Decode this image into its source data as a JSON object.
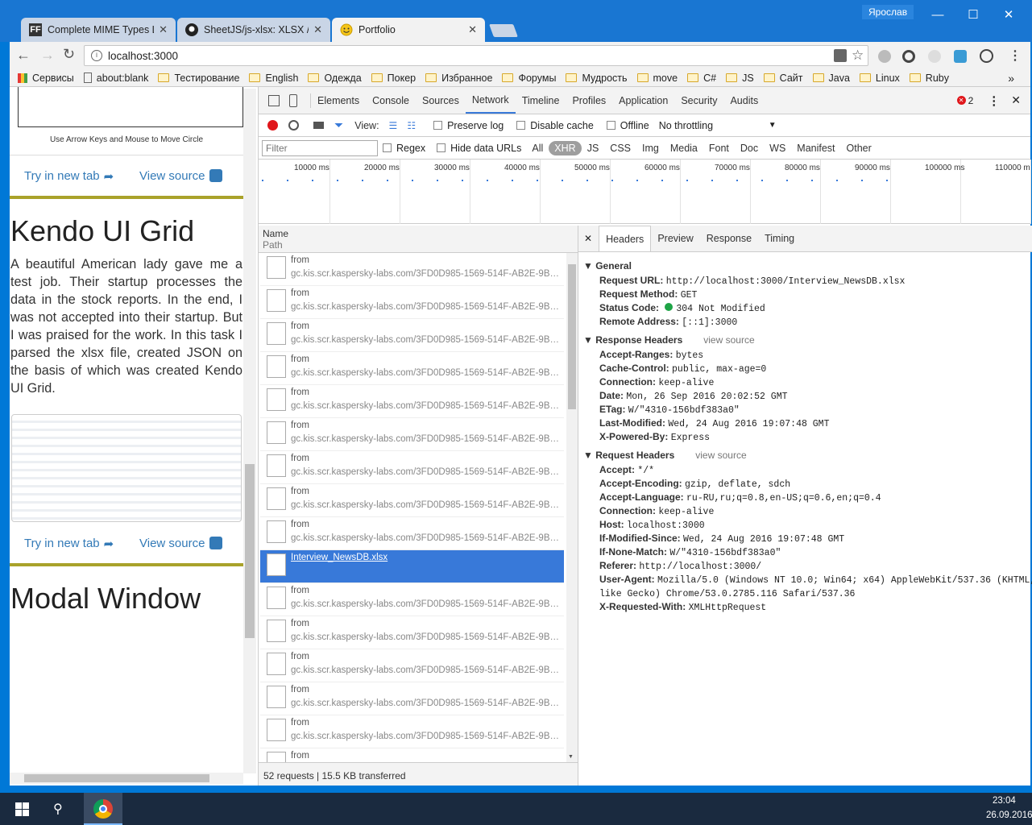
{
  "window": {
    "user": "Ярослав",
    "minimize": "—",
    "maximize": "☐",
    "close": "✕"
  },
  "tabs": [
    {
      "label": "Complete MIME Types Li",
      "favicon": "FF"
    },
    {
      "label": "SheetJS/js-xlsx: XLSX / XL",
      "favicon": "github-icon"
    },
    {
      "label": "Portfolio",
      "favicon": "smiley-icon"
    }
  ],
  "address": {
    "url": "localhost:3000"
  },
  "bookmarks": [
    "Сервисы",
    "about:blank",
    "Тестирование",
    "English",
    "Одежда",
    "Покер",
    "Избранное",
    "Форумы",
    "Мудрость",
    "move",
    "C#",
    "JS",
    "Сайт",
    "Java",
    "Linux",
    "Ruby"
  ],
  "page": {
    "canvas_caption": "Use Arrow Keys and Mouse to Move Circle",
    "try_link": "Try in new tab",
    "source_link": "View source",
    "section1_title": "Kendo UI Grid",
    "section1_text": "A beautiful American lady gave me a test job. Their startup processes the data in the stock reports. In the end, I was not accepted into their startup. But I was praised for the work. In this task I parsed the xlsx file, created JSON on the basis of which was created Kendo UI Grid.",
    "section2_title": "Modal Window"
  },
  "devtools": {
    "tabs": [
      "Elements",
      "Console",
      "Sources",
      "Network",
      "Timeline",
      "Profiles",
      "Application",
      "Security",
      "Audits"
    ],
    "active_tab": "Network",
    "error_count": "2",
    "view_label": "View:",
    "preserve_log": "Preserve log",
    "disable_cache": "Disable cache",
    "offline": "Offline",
    "throttling": "No throttling",
    "filter_placeholder": "Filter",
    "regex": "Regex",
    "hide_data_urls": "Hide data URLs",
    "types": [
      "All",
      "XHR",
      "JS",
      "CSS",
      "Img",
      "Media",
      "Font",
      "Doc",
      "WS",
      "Manifest",
      "Other"
    ],
    "active_type": "XHR",
    "timeline_ticks": [
      "10000 ms",
      "20000 ms",
      "30000 ms",
      "40000 ms",
      "50000 ms",
      "60000 ms",
      "70000 ms",
      "80000 ms",
      "90000 ms",
      "100000 ms",
      "110000 m"
    ],
    "col_name": "Name",
    "col_path": "Path",
    "requests": [
      {
        "name": "from",
        "path": "gc.kis.scr.kaspersky-labs.com/3FD0D985-1569-514F-AB2E-9B42D64..."
      },
      {
        "name": "from",
        "path": "gc.kis.scr.kaspersky-labs.com/3FD0D985-1569-514F-AB2E-9B42D64..."
      },
      {
        "name": "from",
        "path": "gc.kis.scr.kaspersky-labs.com/3FD0D985-1569-514F-AB2E-9B42D64..."
      },
      {
        "name": "from",
        "path": "gc.kis.scr.kaspersky-labs.com/3FD0D985-1569-514F-AB2E-9B42D64..."
      },
      {
        "name": "from",
        "path": "gc.kis.scr.kaspersky-labs.com/3FD0D985-1569-514F-AB2E-9B42D64..."
      },
      {
        "name": "from",
        "path": "gc.kis.scr.kaspersky-labs.com/3FD0D985-1569-514F-AB2E-9B42D64..."
      },
      {
        "name": "from",
        "path": "gc.kis.scr.kaspersky-labs.com/3FD0D985-1569-514F-AB2E-9B42D64..."
      },
      {
        "name": "from",
        "path": "gc.kis.scr.kaspersky-labs.com/3FD0D985-1569-514F-AB2E-9B42D64..."
      },
      {
        "name": "from",
        "path": "gc.kis.scr.kaspersky-labs.com/3FD0D985-1569-514F-AB2E-9B42D64..."
      },
      {
        "name": "Interview_NewsDB.xlsx",
        "path": ""
      },
      {
        "name": "from",
        "path": "gc.kis.scr.kaspersky-labs.com/3FD0D985-1569-514F-AB2E-9B42D64..."
      },
      {
        "name": "from",
        "path": "gc.kis.scr.kaspersky-labs.com/3FD0D985-1569-514F-AB2E-9B42D64..."
      },
      {
        "name": "from",
        "path": "gc.kis.scr.kaspersky-labs.com/3FD0D985-1569-514F-AB2E-9B42D64..."
      },
      {
        "name": "from",
        "path": "gc.kis.scr.kaspersky-labs.com/3FD0D985-1569-514F-AB2E-9B42D64..."
      },
      {
        "name": "from",
        "path": "gc.kis.scr.kaspersky-labs.com/3FD0D985-1569-514F-AB2E-9B42D64..."
      },
      {
        "name": "from",
        "path": ""
      }
    ],
    "selected_request": 9,
    "summary": "52 requests  |  15.5 KB transferred",
    "detail_tabs": [
      "Headers",
      "Preview",
      "Response",
      "Timing"
    ],
    "general_title": "General",
    "general": [
      {
        "k": "Request URL:",
        "v": "http://localhost:3000/Interview_NewsDB.xlsx"
      },
      {
        "k": "Request Method:",
        "v": "GET"
      },
      {
        "k": "Status Code:",
        "v": "304 Not Modified"
      },
      {
        "k": "Remote Address:",
        "v": "[::1]:3000"
      }
    ],
    "response_title": "Response Headers",
    "view_source": "view source",
    "response": [
      {
        "k": "Accept-Ranges:",
        "v": "bytes"
      },
      {
        "k": "Cache-Control:",
        "v": "public, max-age=0"
      },
      {
        "k": "Connection:",
        "v": "keep-alive"
      },
      {
        "k": "Date:",
        "v": "Mon, 26 Sep 2016 20:02:52 GMT"
      },
      {
        "k": "ETag:",
        "v": "W/\"4310-156bdf383a0\""
      },
      {
        "k": "Last-Modified:",
        "v": "Wed, 24 Aug 2016 19:07:48 GMT"
      },
      {
        "k": "X-Powered-By:",
        "v": "Express"
      }
    ],
    "request_title": "Request Headers",
    "request": [
      {
        "k": "Accept:",
        "v": "*/*"
      },
      {
        "k": "Accept-Encoding:",
        "v": "gzip, deflate, sdch"
      },
      {
        "k": "Accept-Language:",
        "v": "ru-RU,ru;q=0.8,en-US;q=0.6,en;q=0.4"
      },
      {
        "k": "Connection:",
        "v": "keep-alive"
      },
      {
        "k": "Host:",
        "v": "localhost:3000"
      },
      {
        "k": "If-Modified-Since:",
        "v": "Wed, 24 Aug 2016 19:07:48 GMT"
      },
      {
        "k": "If-None-Match:",
        "v": "W/\"4310-156bdf383a0\""
      },
      {
        "k": "Referer:",
        "v": "http://localhost:3000/"
      },
      {
        "k": "User-Agent:",
        "v": "Mozilla/5.0 (Windows NT 10.0; Win64; x64) AppleWebKit/537.36 (KHTML,"
      },
      {
        "k": "",
        "v": " like Gecko) Chrome/53.0.2785.116 Safari/537.36"
      },
      {
        "k": "X-Requested-With:",
        "v": "XMLHttpRequest"
      }
    ]
  },
  "taskbar": {
    "time": "23:04",
    "date": "26.09.2016"
  },
  "colors": {
    "accent": "#3879d9",
    "olive": "#a9a22a",
    "link": "#337ab7",
    "record": "#e0161b",
    "status_ok": "#1ea446"
  }
}
